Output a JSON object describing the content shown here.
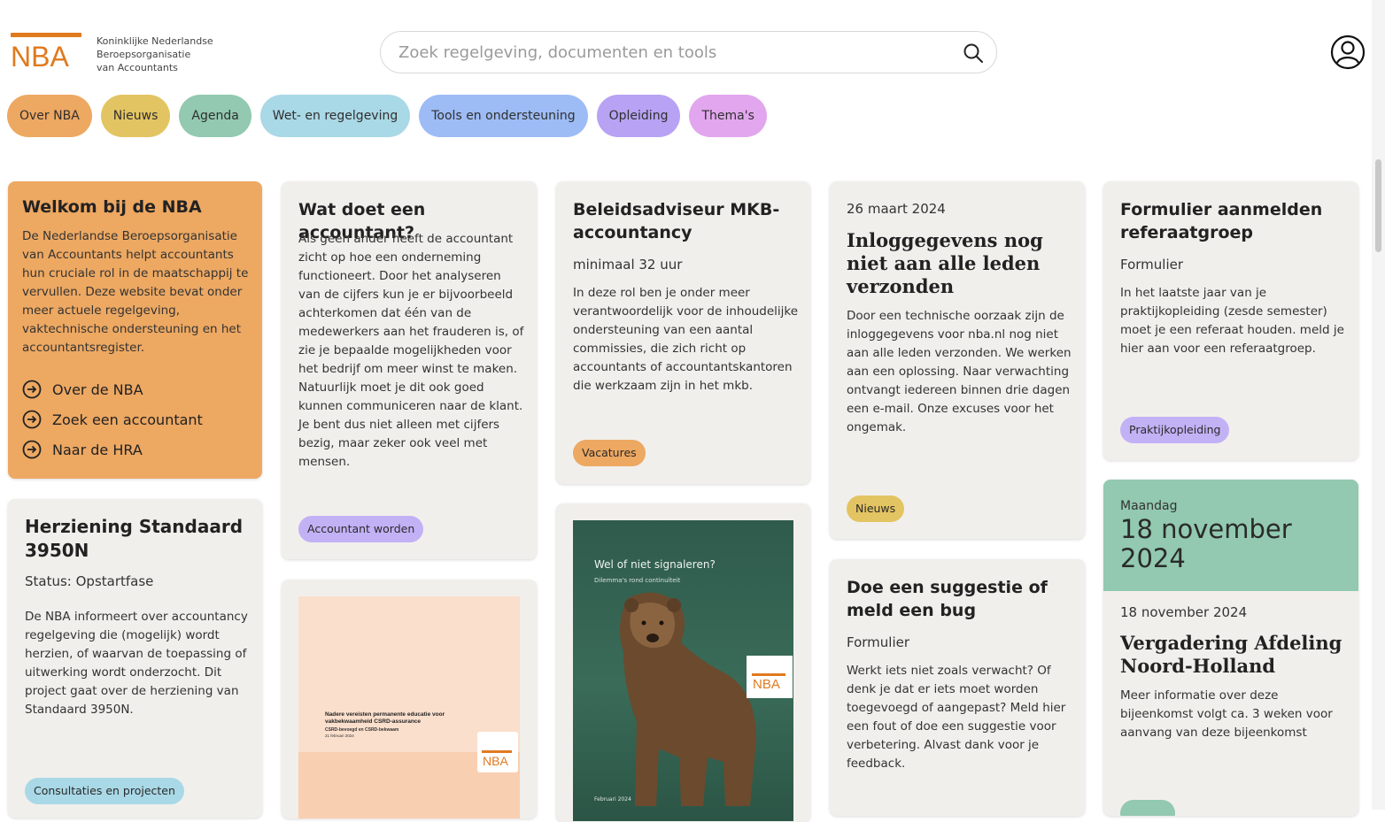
{
  "logo": {
    "word": "NBA",
    "line1": "Koninklijke Nederlandse",
    "line2": "Beroepsorganisatie",
    "line3": "van Accountants",
    "color": "#e07a1f"
  },
  "search": {
    "placeholder": "Zoek regelgeving, documenten en tools",
    "icon": "search-icon"
  },
  "header": {
    "user_icon": "user-icon"
  },
  "nav": [
    {
      "label": "Over NBA",
      "color": "#eda862"
    },
    {
      "label": "Nieuws",
      "color": "#e3c462"
    },
    {
      "label": "Agenda",
      "color": "#92c9b0"
    },
    {
      "label": "Wet- en regelgeving",
      "color": "#a9d8e6"
    },
    {
      "label": "Tools en ondersteuning",
      "color": "#9dbcf6"
    },
    {
      "label": "Opleiding",
      "color": "#b7a2f4"
    },
    {
      "label": "Thema's",
      "color": "#e2a6ee"
    }
  ],
  "welcome": {
    "title": "Welkom bij de NBA",
    "text": "De Nederlandse Beroepsorganisatie van Accountants helpt accountants hun cruciale rol in de maatschappij te vervullen. Deze website bevat onder meer actuele regelgeving, vaktechnische ondersteuning en het accountantsregister.",
    "links": [
      "Over de NBA",
      "Zoek een accountant",
      "Naar de HRA"
    ]
  },
  "cards": {
    "accountant": {
      "title": "Wat doet een accountant?",
      "text": "Als geen ander heeft de accountant zicht op hoe een onderneming functioneert. Door het analyseren van de cijfers kun je er bijvoorbeeld achterkomen dat één van de medewerkers aan het frauderen is, of zie je bepaalde mogelijkheden voor het bedrijf om meer winst te maken. Natuurlijk moet je dit ook goed kunnen communiceren naar de klant. Je bent dus niet alleen met cijfers bezig, maar zeker ook veel met mensen.",
      "tag": "Accountant worden"
    },
    "vacature": {
      "title": "Beleidsadviseur MKB-accountancy",
      "sub": "minimaal 32 uur",
      "text": "In deze rol ben je onder meer verantwoordelijk voor de inhoudelijke ondersteuning van een aantal commissies, die zich richt op accountants of accountantskantoren die werkzaam zijn in het mkb.",
      "tag": "Vacatures"
    },
    "news": {
      "date": "26 maart 2024",
      "title": "Inloggegevens nog niet aan alle leden verzonden",
      "text": "Door een technische oorzaak zijn de inloggegevens voor nba.nl nog niet aan alle leden verzonden. We werken aan een oplossing. Naar verwachting ontvangt iedereen binnen drie dagen een e-mail. Onze excuses voor het ongemak.",
      "tag": "Nieuws"
    },
    "formulier": {
      "title": "Formulier aanmelden referaatgroep",
      "sub": "Formulier",
      "text": "In het laatste jaar van je praktijkopleiding (zesde semester) moet je een referaat houden. meld je hier aan voor een referaatgroep.",
      "tag": "Praktijkopleiding"
    },
    "herziening": {
      "title": "Herziening Standaard 3950N",
      "sub": "Status: Opstartfase",
      "text": "De NBA informeert over accountancy regelgeving die (mogelijk) wordt herzien, of waarvan de toepassing of uitwerking wordt onderzocht. Dit project gaat over de herziening van Standaard 3950N.",
      "tag": "Consultaties en projecten"
    },
    "csrd": {
      "cover_title": "Nadere vereisten permanente educatie voor vakbekwaamheid CSRD-assurance",
      "cover_sub": "CSRD-bevoegd en CSRD-bekwaam",
      "cover_date": "21 februari 2024",
      "cover_logo": "NBA"
    },
    "bear": {
      "cover_title": "Wel of niet signaleren?",
      "cover_sub": "Dilemma's rond continuïteit",
      "cover_date": "Februari 2024",
      "cover_logo": "NBA"
    },
    "bug": {
      "title": "Doe een suggestie of meld een bug",
      "sub": "Formulier",
      "text": "Werkt iets niet zoals verwacht? Of denk je dat er iets moet worden toegevoegd of aangepast? Meld hier een fout of doe een suggestie voor verbetering. Alvast dank voor je feedback."
    },
    "event": {
      "weekday": "Maandag",
      "date_big": "18 november 2024",
      "date": "18 november 2024",
      "title": "Vergadering Afdeling Noord-Holland",
      "text": "Meer informatie over deze bijeenkomst volgt ca. 3 weken voor aanvang van deze bijeenkomst"
    }
  },
  "colors": {
    "orange": "#eda862",
    "green": "#92c9b0",
    "card_bg": "#f1efec",
    "purple_tag": "#c3b1f6",
    "blue_tag": "#a9d8e6",
    "yellow_tag": "#e3c462"
  }
}
